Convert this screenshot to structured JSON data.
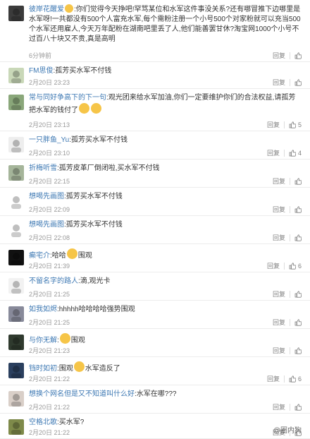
{
  "labels": {
    "reply": "回复",
    "like": "赞"
  },
  "comments": [
    {
      "name": "彼岸花醒爱",
      "text": ":你们觉得今天挣吧!罕骂某位和水军这件事没关系?还有哪冒推下边哪里是水军呀!一共都没有500个人富充水军,每个需粉注册一个小号500个对家粉就可以充当500个水军还用雇人,今天万年配粉在湖南吧里丢了人,他们能善罢甘休?淘宝网1000个小号不过百八十块又不贵,真是高明",
      "time": "6分钟前",
      "likes": ""
    },
    {
      "name": "FM思俊",
      "text": ":孤芳买水军不付钱",
      "time": "2月20日 23:23",
      "likes": ""
    },
    {
      "name": "常与同好争高下的下一句",
      "text": ":观光团来给水军加油,你们一定要维护你们的合法权益,请孤芳把水军的钱付了",
      "time": "2月20日 23:13",
      "likes": "5"
    },
    {
      "name": "一只胖鱼_Yu",
      "text": ":孤芳买水军不付钱",
      "time": "2月20日 23:10",
      "likes": "4"
    },
    {
      "name": "折梅听雪",
      "text": ":孤芳皮革厂倒闭啦,买水军不付钱",
      "time": "2月20日 22:15",
      "likes": ""
    },
    {
      "name": "想喝先画图",
      "text": ":孤芳买水军不付钱",
      "time": "2月20日 22:09",
      "likes": ""
    },
    {
      "name": "想喝先画图",
      "text": ":孤芳买水军不付钱",
      "time": "2月20日 22:08",
      "likes": ""
    },
    {
      "name": "癫宅介",
      "text": ":哈哈",
      "text2": "围观",
      "time": "2月20日 21:39",
      "likes": "6"
    },
    {
      "name": "不留名字的路人",
      "text": ":滴,观光卡",
      "time": "2月20日 21:25",
      "likes": ""
    },
    {
      "name": "如我如烬",
      "text": ":hhhhh哈哈哈哈强势围观",
      "time": "2月20日 21:25",
      "likes": ""
    },
    {
      "name": "与你无解",
      "text": ":",
      "text2": "围观",
      "time": "2月20日 21:23",
      "likes": ""
    },
    {
      "name": "铛时如初",
      "text": ":围观",
      "text2": "水军造反了",
      "time": "2月20日 21:22",
      "likes": "6"
    },
    {
      "name": "想换个网名但是又不知道叫什么好",
      "text": ":水军在哪???",
      "time": "2月20日 21:22",
      "likes": ""
    },
    {
      "name": "空格北歌",
      "text": ":买水军?",
      "time": "2月20日 21:22",
      "likes": ""
    }
  ],
  "watermark": "@圈内狗",
  "colors": {
    "name": "#eb7350",
    "link": "#3d78b3"
  }
}
